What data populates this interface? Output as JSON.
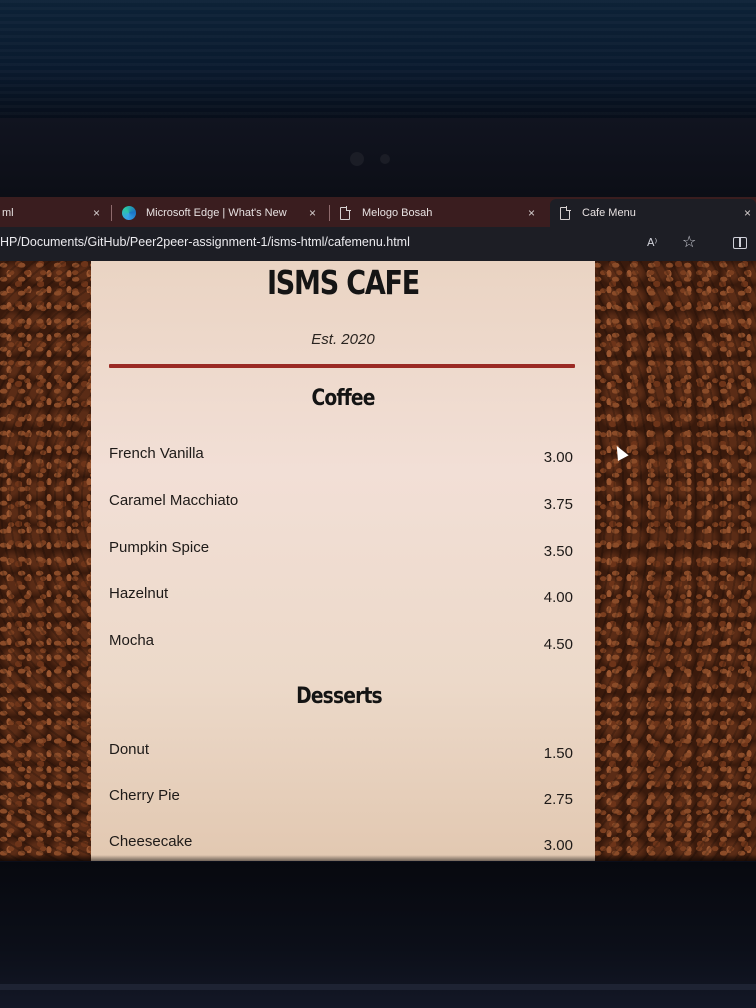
{
  "browser": {
    "tabs": [
      {
        "label": "ml",
        "icon": "none",
        "close": "×"
      },
      {
        "label": "Microsoft Edge | What's New",
        "icon": "edge-icon",
        "close": "×"
      },
      {
        "label": "Melogo Bosah",
        "icon": "page-icon",
        "close": "×"
      },
      {
        "label": "Cafe Menu",
        "icon": "page-icon",
        "close": "×",
        "active": true
      }
    ],
    "url": "HP/Documents/GitHub/Peer2peer-assignment-1/isms-html/cafemenu.html",
    "read_aloud": "A⁾",
    "favorite": "☆"
  },
  "menu": {
    "title": "ISMS CAFE",
    "established": "Est. 2020",
    "sections": [
      {
        "title": "Coffee",
        "items": [
          {
            "name": "French Vanilla",
            "price": "3.00"
          },
          {
            "name": "Caramel Macchiato",
            "price": "3.75"
          },
          {
            "name": "Pumpkin Spice",
            "price": "3.50"
          },
          {
            "name": "Hazelnut",
            "price": "4.00"
          },
          {
            "name": "Mocha",
            "price": "4.50"
          }
        ]
      },
      {
        "title": "Desserts",
        "items": [
          {
            "name": "Donut",
            "price": "1.50"
          },
          {
            "name": "Cherry Pie",
            "price": "2.75"
          },
          {
            "name": "Cheesecake",
            "price": "3.00"
          }
        ]
      }
    ]
  },
  "colors": {
    "rule": "#9b2a24",
    "menu_bg": "#f0ddd2",
    "tab_bar": "#3a1d1f",
    "address_bar": "#1d1e25"
  }
}
